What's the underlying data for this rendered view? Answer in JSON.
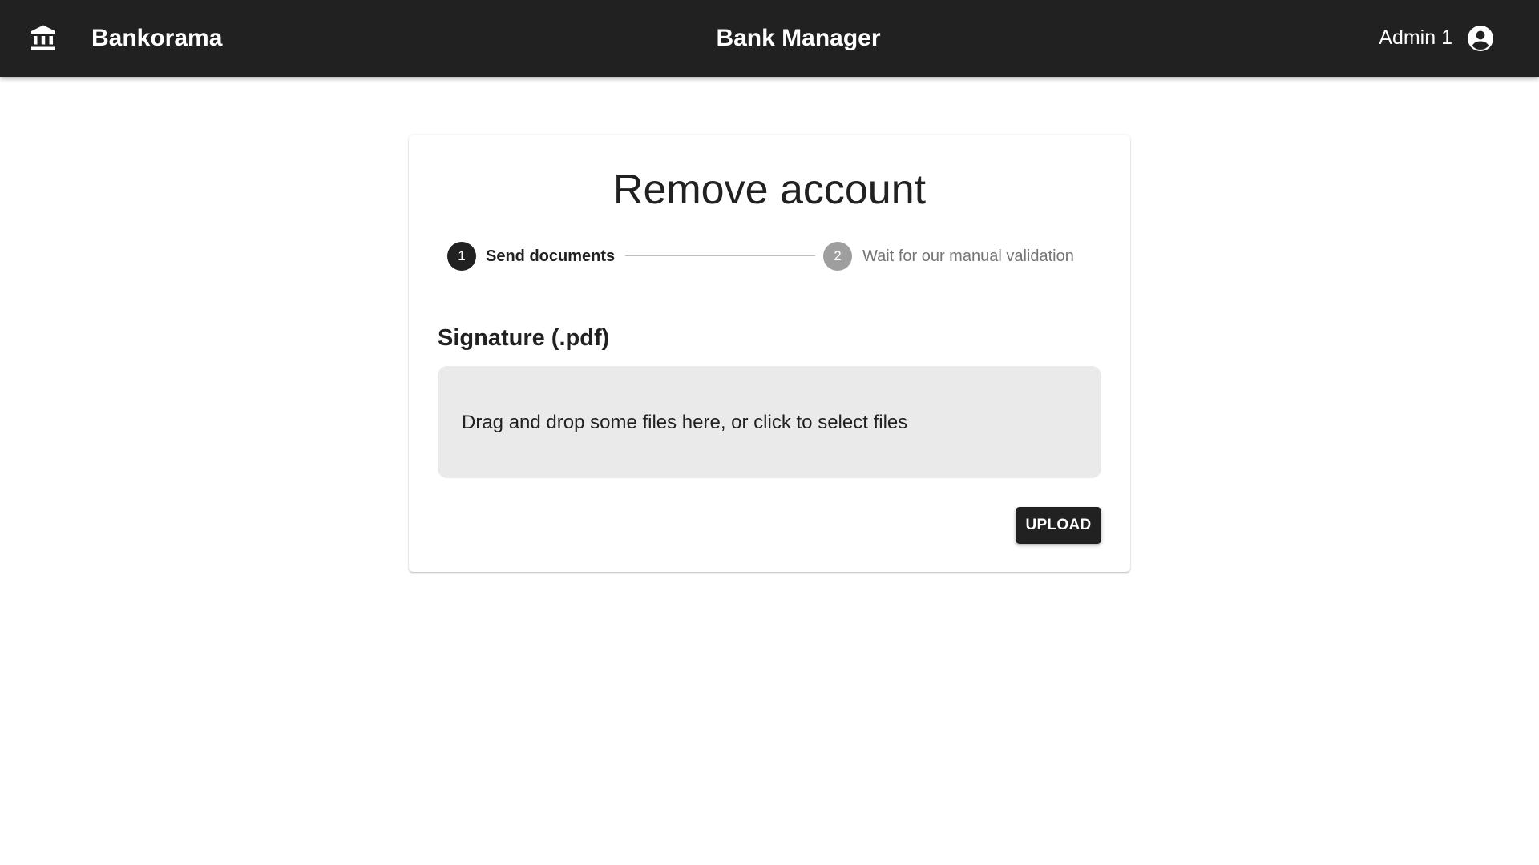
{
  "appbar": {
    "brand": "Bankorama",
    "title": "Bank Manager",
    "user_name": "Admin 1",
    "brand_icon": "bank-icon",
    "user_icon": "account-circle-icon",
    "background_color": "#212121"
  },
  "card": {
    "title": "Remove account",
    "stepper": {
      "steps": [
        {
          "number": "1",
          "label": "Send documents",
          "state": "active"
        },
        {
          "number": "2",
          "label": "Wait for our manual validation",
          "state": "inactive"
        }
      ]
    },
    "upload_section": {
      "title": "Signature (.pdf)",
      "dropzone_text": "Drag and drop some files here, or click to select files",
      "upload_button_label": "UPLOAD"
    }
  },
  "colors": {
    "primary": "#212121",
    "inactive_step": "#9e9e9e",
    "dropzone_bg": "#eaeaea"
  }
}
